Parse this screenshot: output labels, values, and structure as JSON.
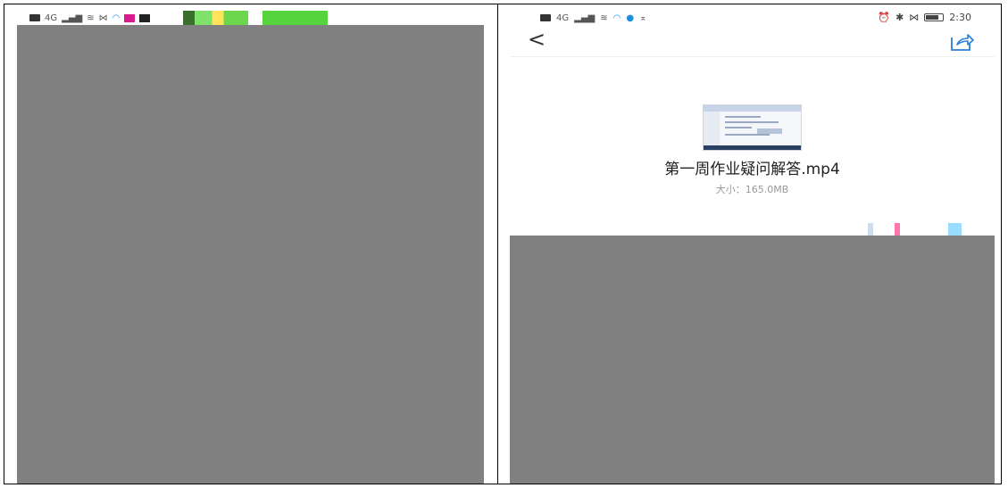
{
  "left_phone": {
    "status_bar": {
      "signal": "4G",
      "icons": [
        "hd-icon",
        "signal-icon",
        "wifi-icon",
        "dnd-icon",
        "app-icon",
        "pink-app-icon",
        "dark-app-icon"
      ]
    }
  },
  "right_phone": {
    "status_bar": {
      "signal": "4G",
      "time": "2:30",
      "icons": [
        "hd-icon",
        "signal-icon",
        "wifi-icon",
        "app-icon",
        "app-icon",
        "location-icon",
        "alarm-icon",
        "bluetooth-icon",
        "mute-icon",
        "battery-icon"
      ]
    },
    "header": {
      "back_glyph": "<"
    },
    "file": {
      "name": "第一周作业疑问解答.mp4",
      "size_text": "大小：165.0MB"
    }
  }
}
